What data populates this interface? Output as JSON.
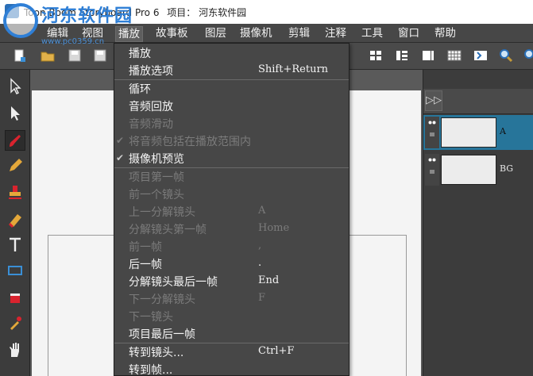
{
  "window": {
    "title": "Toon Boom Storyboard Pro 6",
    "project_label": "项目：",
    "project_name": "河东软件园"
  },
  "watermark": {
    "title": "河东软件园",
    "url": "www.pc0359.cn"
  },
  "menubar": {
    "items": [
      {
        "label": "编辑"
      },
      {
        "label": "视图"
      },
      {
        "label": "播放"
      },
      {
        "label": "故事板"
      },
      {
        "label": "图层"
      },
      {
        "label": "摄像机"
      },
      {
        "label": "剪辑"
      },
      {
        "label": "注释"
      },
      {
        "label": "工具"
      },
      {
        "label": "窗口"
      },
      {
        "label": "帮助"
      }
    ],
    "active_index": 2
  },
  "toolbar": {
    "icons": [
      "new-icon",
      "open-icon",
      "save-icon",
      "save-as-icon",
      "layout-icon-1",
      "layout-icon-2",
      "layout-icon-3",
      "layout-icon-4",
      "grid-icon",
      "timeline-icon",
      "zoom-in-icon",
      "zoom-out-icon"
    ]
  },
  "tools": [
    "select-icon",
    "transform-icon",
    "brush-icon",
    "pencil-icon",
    "stamp-icon",
    "eraser-icon",
    "text-icon",
    "rectangle-icon",
    "paint-bucket-icon",
    "dropper-icon",
    "hand-icon"
  ],
  "layers": [
    {
      "name": "A",
      "active": true
    },
    {
      "name": "BG",
      "active": false
    }
  ],
  "play_menu": {
    "items": [
      {
        "label": "播放",
        "shortcut": "",
        "enabled": true,
        "checked": false
      },
      {
        "label": "播放选项",
        "shortcut": "Shift+Return",
        "enabled": true,
        "checked": false
      },
      {
        "label": "循环",
        "shortcut": "",
        "enabled": true,
        "checked": false
      },
      {
        "label": "音频回放",
        "shortcut": "",
        "enabled": true,
        "checked": false
      },
      {
        "label": "音频滑动",
        "shortcut": "",
        "enabled": false,
        "checked": false
      },
      {
        "label": "将音频包括在播放范围内",
        "shortcut": "",
        "enabled": false,
        "checked": true
      },
      {
        "label": "摄像机预览",
        "shortcut": "",
        "enabled": true,
        "checked": true
      },
      {
        "label": "项目第一帧",
        "shortcut": "",
        "enabled": false,
        "checked": false
      },
      {
        "label": "前一个镜头",
        "shortcut": "",
        "enabled": false,
        "checked": false
      },
      {
        "label": "上一分解镜头",
        "shortcut": "A",
        "enabled": false,
        "checked": false
      },
      {
        "label": "分解镜头第一帧",
        "shortcut": "Home",
        "enabled": false,
        "checked": false
      },
      {
        "label": "前一帧",
        "shortcut": ",",
        "enabled": false,
        "checked": false
      },
      {
        "label": "后一帧",
        "shortcut": ".",
        "enabled": true,
        "checked": false
      },
      {
        "label": "分解镜头最后一帧",
        "shortcut": "End",
        "enabled": true,
        "checked": false
      },
      {
        "label": "下一分解镜头",
        "shortcut": "F",
        "enabled": false,
        "checked": false
      },
      {
        "label": "下一镜头",
        "shortcut": "",
        "enabled": false,
        "checked": false
      },
      {
        "label": "项目最后一帧",
        "shortcut": "",
        "enabled": true,
        "checked": false
      },
      {
        "label": "转到镜头...",
        "shortcut": "Ctrl+F",
        "enabled": true,
        "checked": false
      },
      {
        "label": "转到帧...",
        "shortcut": "",
        "enabled": true,
        "checked": false
      }
    ]
  },
  "colors": {
    "accent": "#27759a",
    "menu_bg": "#474747",
    "disabled_text": "#7b7b7b"
  }
}
